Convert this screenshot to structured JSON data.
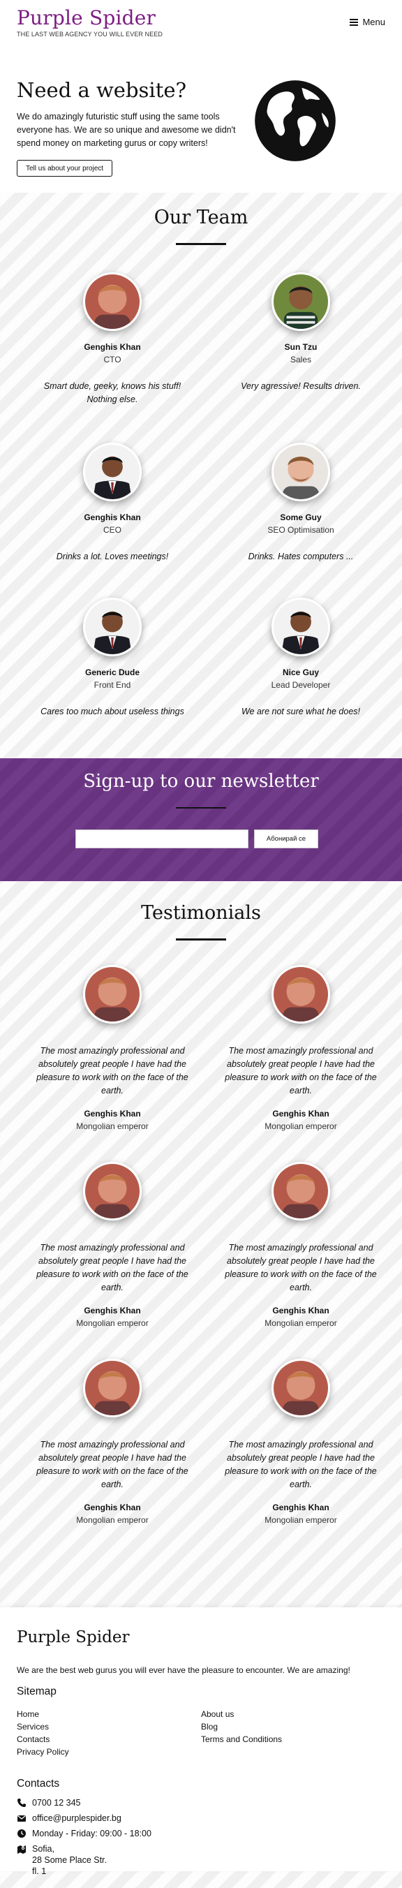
{
  "header": {
    "brand_title": "Purple Spider",
    "tagline": "THE LAST WEB AGENCY YOU WILL EVER NEED",
    "menu_label": "Menu"
  },
  "hero": {
    "title": "Need a website?",
    "text": "We do amazingly futuristic stuff using the same tools everyone has. We are so unique and awesome we didn't spend money on marketing gurus or copy writers!",
    "button": "Tell us about your project",
    "icon": "globe-icon"
  },
  "team": {
    "title": "Our Team",
    "members": [
      {
        "name": "Genghis Khan",
        "role": "CTO",
        "quote": "Smart dude, geeky, knows his stuff! Nothing else."
      },
      {
        "name": "Sun Tzu",
        "role": "Sales",
        "quote": "Very agressive! Results driven."
      },
      {
        "name": "Genghis Khan",
        "role": "CEO",
        "quote": "Drinks a lot. Loves meetings!"
      },
      {
        "name": "Some Guy",
        "role": "SEO Optimisation",
        "quote": "Drinks. Hates computers ..."
      },
      {
        "name": "Generic Dude",
        "role": "Front End",
        "quote": "Cares too much about useless things"
      },
      {
        "name": "Nice Guy",
        "role": "Lead Developer",
        "quote": "We are not sure what he does!"
      }
    ]
  },
  "newsletter": {
    "title": "Sign-up to our newsletter",
    "input_value": "",
    "button": "Абонирай се"
  },
  "testimonials": {
    "title": "Testimonials",
    "items": [
      {
        "quote": "The most amazingly professional and absolutely great people I have had the pleasure to work with on the face of the earth.",
        "name": "Genghis Khan",
        "role": "Mongolian emperor"
      },
      {
        "quote": "The most amazingly professional and absolutely great people I have had the pleasure to work with on the face of the earth.",
        "name": "Genghis Khan",
        "role": "Mongolian emperor"
      },
      {
        "quote": "The most amazingly professional and absolutely great people I have had the pleasure to work with on the face of the earth.",
        "name": "Genghis Khan",
        "role": "Mongolian emperor"
      },
      {
        "quote": "The most amazingly professional and absolutely great people I have had the pleasure to work with on the face of the earth.",
        "name": "Genghis Khan",
        "role": "Mongolian emperor"
      },
      {
        "quote": "The most amazingly professional and absolutely great people I have had the pleasure to work with on the face of the earth.",
        "name": "Genghis Khan",
        "role": "Mongolian emperor"
      },
      {
        "quote": "The most amazingly professional and absolutely great people I have had the pleasure to work with on the face of the earth.",
        "name": "Genghis Khan",
        "role": "Mongolian emperor"
      }
    ]
  },
  "footer": {
    "title": "Purple Spider",
    "description": "We are the best web gurus you will ever have the pleasure to encounter. We are amazing!",
    "sitemap_title": "Sitemap",
    "sitemap_left": [
      "Home",
      "Services",
      "Contacts",
      "Privacy Policy"
    ],
    "sitemap_right": [
      "About us",
      "Blog",
      "Terms and Conditions"
    ],
    "contacts_title": "Contacts",
    "phone": "0700 12 345",
    "email": "office@purplespider.bg",
    "hours": "Monday - Friday: 09:00 - 18:00",
    "address_line1": "Sofia,",
    "address_line2": "28 Some Place Str.",
    "address_line3": "fl. 1"
  },
  "colors": {
    "brand": "#7d1d83",
    "newsletter_bg": "#6b3584"
  }
}
